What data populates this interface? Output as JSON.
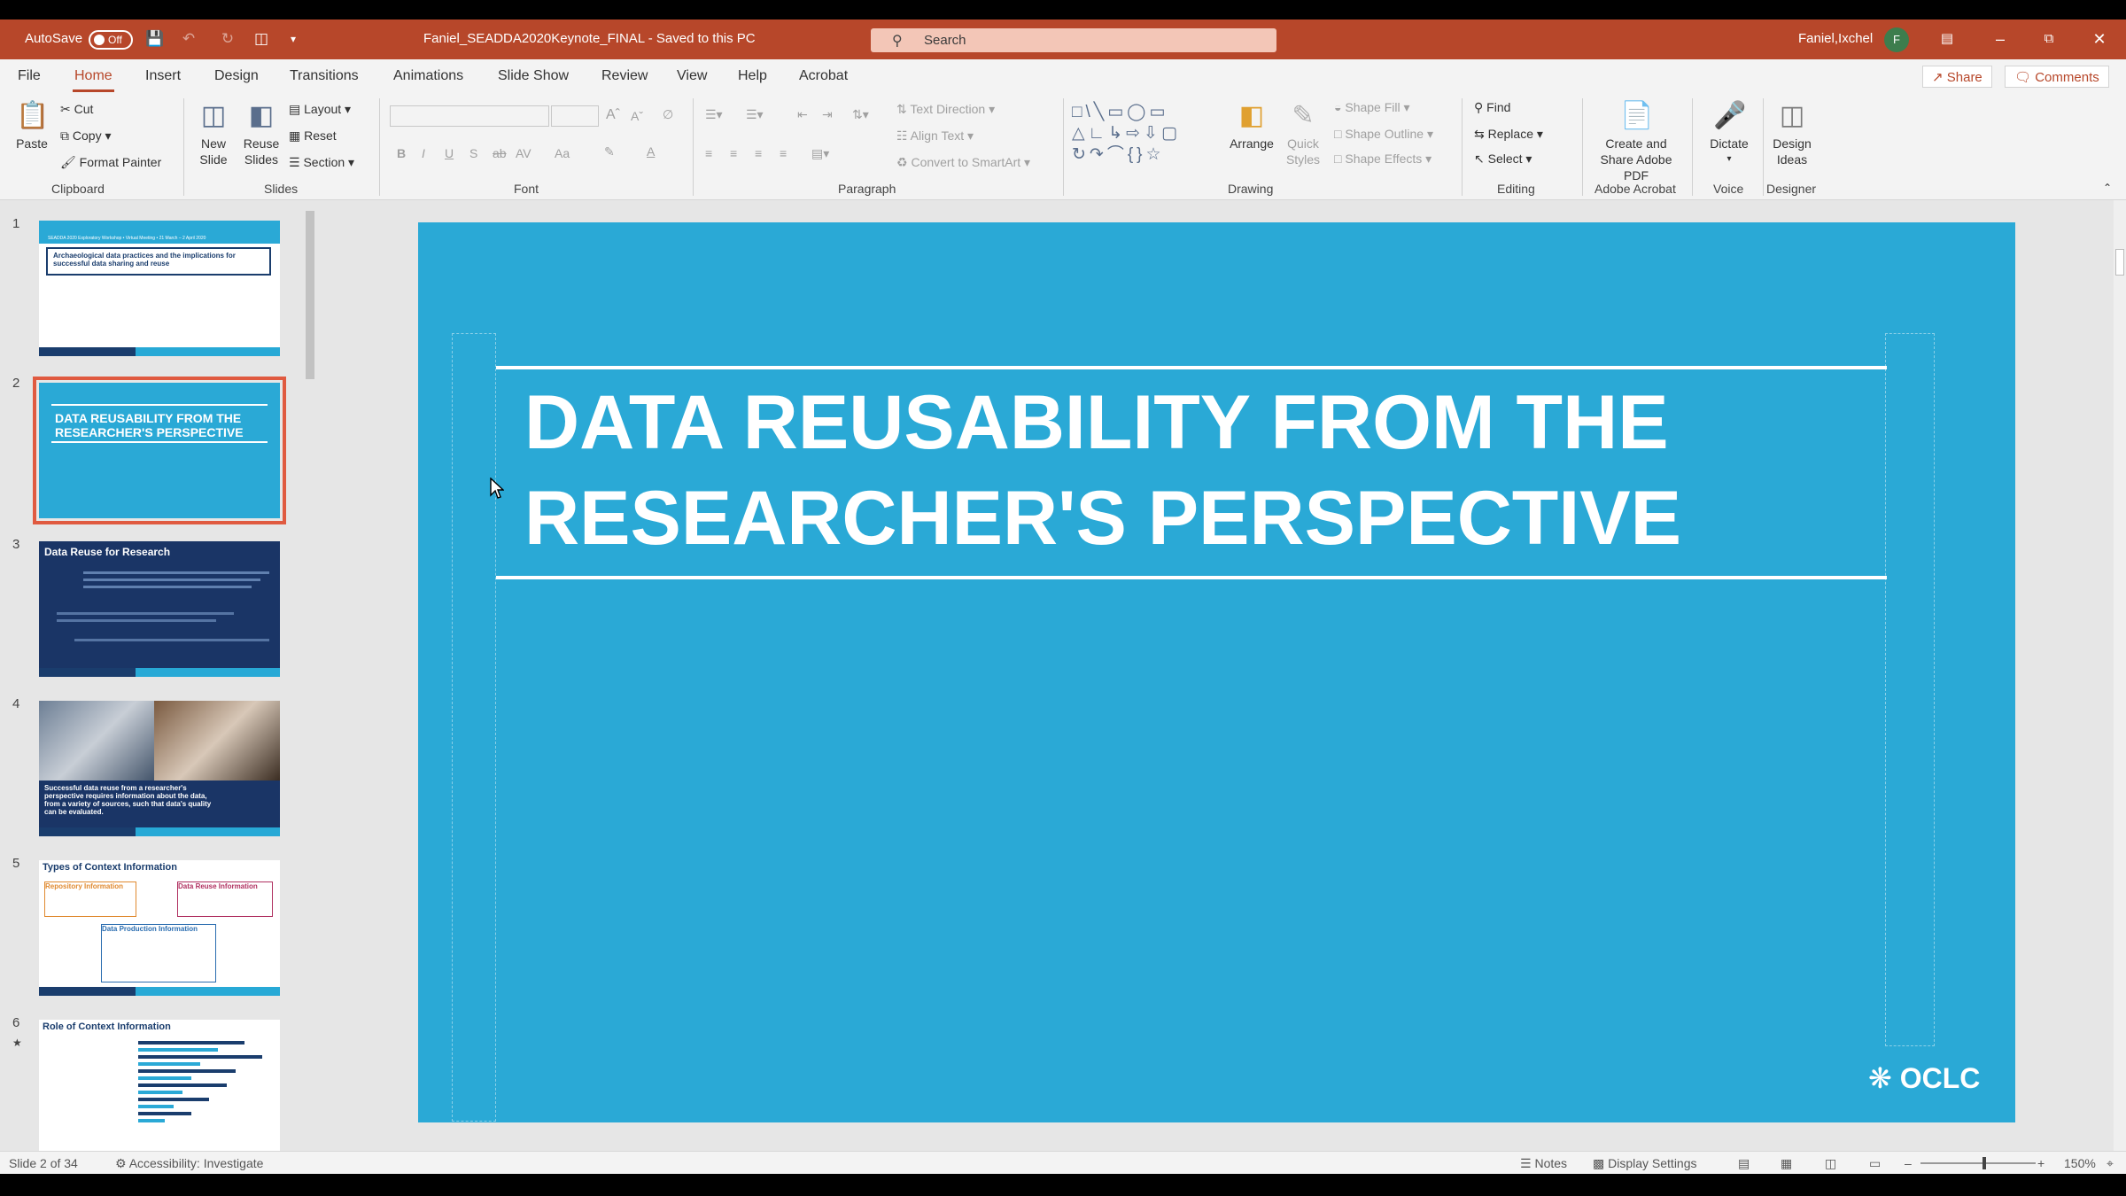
{
  "titlebar": {
    "autosave_label": "AutoSave",
    "autosave_state": "Off",
    "document_title": "Faniel_SEADDA2020Keynote_FINAL  -  Saved to this PC",
    "search_placeholder": "Search",
    "user_name": "Faniel,Ixchel",
    "user_initial": "F",
    "accent_color": "#b7472a"
  },
  "tabs": [
    "File",
    "Home",
    "Insert",
    "Design",
    "Transitions",
    "Animations",
    "Slide Show",
    "Review",
    "View",
    "Help",
    "Acrobat"
  ],
  "active_tab": "Home",
  "topbar_actions": {
    "share": "Share",
    "comments": "Comments"
  },
  "ribbon": {
    "clipboard": {
      "paste": "Paste",
      "cut": "Cut",
      "copy": "Copy",
      "format_painter": "Format Painter",
      "group": "Clipboard"
    },
    "slides": {
      "new_slide": "New Slide",
      "reuse_slides": "Reuse Slides",
      "layout": "Layout",
      "reset": "Reset",
      "section": "Section",
      "group": "Slides"
    },
    "font": {
      "group": "Font",
      "bold": "B",
      "italic": "I",
      "underline": "U",
      "strike": "S",
      "strike2": "ab",
      "spacing": "AV",
      "case": "Aa",
      "color": "A"
    },
    "paragraph": {
      "text_direction": "Text Direction",
      "align_text": "Align Text",
      "convert_smartart": "Convert to SmartArt",
      "group": "Paragraph"
    },
    "drawing": {
      "arrange": "Arrange",
      "quick_styles": "Quick Styles",
      "shape_fill": "Shape Fill",
      "shape_outline": "Shape Outline",
      "shape_effects": "Shape Effects",
      "group": "Drawing"
    },
    "editing": {
      "find": "Find",
      "replace": "Replace",
      "select": "Select",
      "group": "Editing"
    },
    "acrobat": {
      "create_share": "Create and Share Adobe PDF",
      "group": "Adobe Acrobat"
    },
    "voice": {
      "dictate": "Dictate",
      "group": "Voice"
    },
    "designer": {
      "design_ideas": "Design Ideas",
      "group": "Designer"
    }
  },
  "thumbnails": [
    {
      "num": "1",
      "title": "Archaeological data practices and the implications for successful data sharing and reuse",
      "header": "SEADDA 2020 Exploratory Workshop • Virtual Meeting • 21 March – 2 April 2020"
    },
    {
      "num": "2",
      "title": "DATA REUSABILITY FROM THE RESEARCHER'S PERSPECTIVE"
    },
    {
      "num": "3",
      "title": "Data Reuse for Research"
    },
    {
      "num": "4",
      "title": "Successful data reuse from a researcher's perspective requires information about the data, from a variety of sources, such that data's quality can be evaluated."
    },
    {
      "num": "5",
      "title": "Types of Context Information",
      "boxes": [
        "Repository Information",
        "Data Reuse Information",
        "Data Production Information"
      ]
    },
    {
      "num": "6",
      "title": "Role of Context Information"
    }
  ],
  "slide": {
    "title_line1": "DATA REUSABILITY FROM THE",
    "title_line2": "RESEARCHER'S PERSPECTIVE",
    "logo_text": "OCLC",
    "background": "#2aa9d6"
  },
  "statusbar": {
    "slide_info": "Slide 2 of 34",
    "accessibility": "Accessibility: Investigate",
    "notes": "Notes",
    "display_settings": "Display Settings",
    "zoom": "150%"
  }
}
